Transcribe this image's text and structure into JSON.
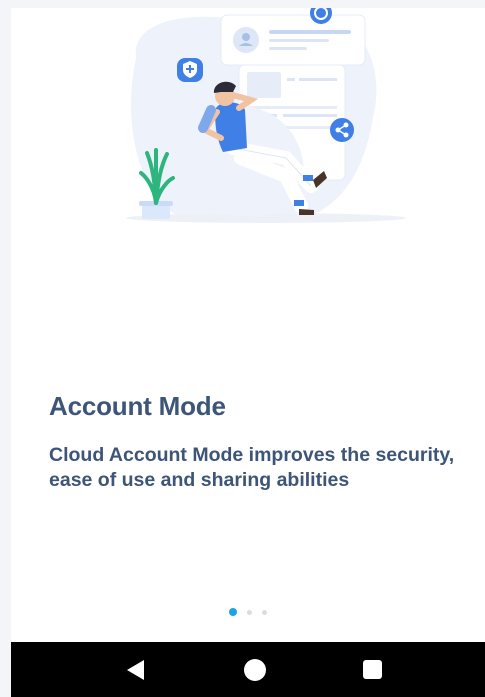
{
  "onboarding": {
    "title": "Account Mode",
    "subtitle": "Cloud Account Mode improves the security, ease of use and sharing abilities",
    "page_indicator": {
      "current": 1,
      "total": 3
    }
  },
  "colors": {
    "title": "#3d5577",
    "accent": "#1aa3e8",
    "illustration_blue": "#3f7fe6",
    "plant_green": "#2cb67d"
  },
  "navbar": {
    "back_icon": "back-triangle-icon",
    "home_icon": "home-circle-icon",
    "recent_icon": "recent-apps-square-icon"
  }
}
